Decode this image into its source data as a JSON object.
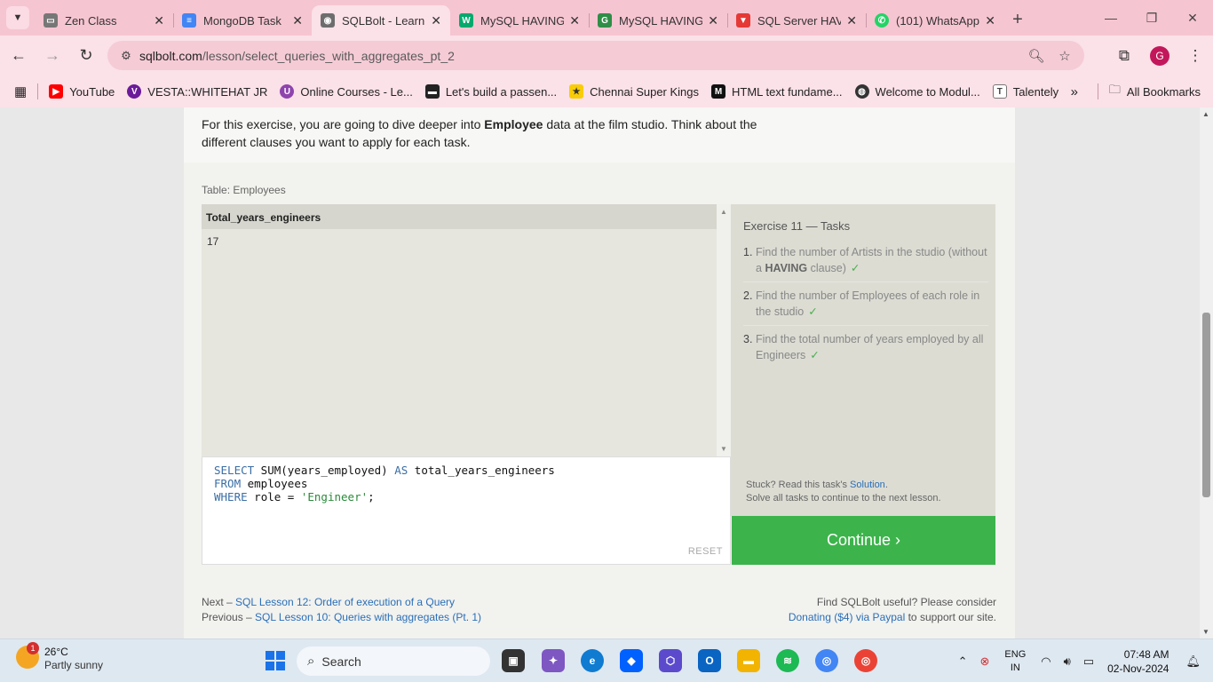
{
  "browser": {
    "tabs": [
      {
        "title": "Zen Class",
        "icon": "zen-class-icon",
        "color": "#555555"
      },
      {
        "title": "MongoDB Task",
        "icon": "google-docs-icon",
        "color": "#4285f4"
      },
      {
        "title": "SQLBolt - Learn",
        "icon": "database-icon",
        "color": "#6d6d6d"
      },
      {
        "title": "MySQL HAVING",
        "icon": "w3schools-icon",
        "color": "#04aa6d"
      },
      {
        "title": "MySQL HAVING",
        "icon": "gfg-icon",
        "color": "#2f8d46"
      },
      {
        "title": "SQL Server HAV",
        "icon": "tutorial-gateway-icon",
        "color": "#e53935"
      },
      {
        "title": "(101) WhatsApp",
        "icon": "whatsapp-icon",
        "color": "#25d366"
      }
    ],
    "address": {
      "domain": "sqlbolt.com",
      "path": "/lesson/select_queries_with_aggregates_pt_2"
    },
    "profile_initial": "G",
    "bookmarks": [
      {
        "label": "YouTube",
        "color": "#ff0000"
      },
      {
        "label": "VESTA::WHITEHAT JR",
        "color": "#6a1b9a"
      },
      {
        "label": "Online Courses - Le...",
        "color": "#8e44ad"
      },
      {
        "label": "Let's build a passen...",
        "color": "#222222"
      },
      {
        "label": "Chennai Super Kings",
        "color": "#f9cd05"
      },
      {
        "label": "HTML text fundame...",
        "color": "#111111"
      },
      {
        "label": "Welcome to Modul...",
        "color": "#333333"
      },
      {
        "label": "Talentely",
        "color": "#ffffff"
      }
    ],
    "all_bookmarks_label": "All Bookmarks"
  },
  "page": {
    "intro_before": "For this exercise, you are going to dive deeper into ",
    "intro_bold": "Employee",
    "intro_after": " data at the film studio. Think about the different clauses you want to apply for each task.",
    "table_caption": "Table: Employees",
    "result_header": "Total_years_engineers",
    "result_value": "17",
    "sql_lines": [
      {
        "kw": "SELECT",
        "rest_a": " SUM(years_employed) ",
        "kw2": "AS",
        "rest_b": " total_years_engineers"
      },
      {
        "kw": "FROM",
        "rest_a": " employees",
        "kw2": "",
        "rest_b": ""
      },
      {
        "kw": "WHERE",
        "rest_a": " role = ",
        "str": "'Engineer'",
        "rest_b": ";"
      }
    ],
    "reset_label": "RESET",
    "tasks_title": "Exercise 11 — Tasks",
    "tasks": [
      {
        "num": "1.",
        "text_a": "Find the number of Artists in the studio (without a ",
        "bold": "HAVING",
        "text_b": " clause)",
        "check": "✓"
      },
      {
        "num": "2.",
        "text_a": "Find the number of Employees of each role in the studio",
        "bold": "",
        "text_b": "",
        "check": "✓"
      },
      {
        "num": "3.",
        "text_a": "Find the total number of years employed by all Engineers",
        "bold": "",
        "text_b": "",
        "check": "✓"
      }
    ],
    "stuck_prefix": "Stuck? Read this task's ",
    "stuck_link": "Solution",
    "stuck_suffix": ".",
    "solve_all": "Solve all tasks to continue to the next lesson.",
    "continue_label": "Continue ›",
    "next_prefix": "Next – ",
    "next_link": "SQL Lesson 12: Order of execution of a Query",
    "prev_prefix": "Previous – ",
    "prev_link": "SQL Lesson 10: Queries with aggregates (Pt. 1)",
    "support_line1": "Find SQLBolt useful? Please consider",
    "support_link": "Donating ($4) via Paypal",
    "support_suffix": " to support our site."
  },
  "taskbar": {
    "weather_temp": "26°C",
    "weather_cond": "Partly sunny",
    "weather_badge": "1",
    "search_label": "Search",
    "lang_line1": "ENG",
    "lang_line2": "IN",
    "time": "07:48 AM",
    "date": "02-Nov-2024"
  }
}
